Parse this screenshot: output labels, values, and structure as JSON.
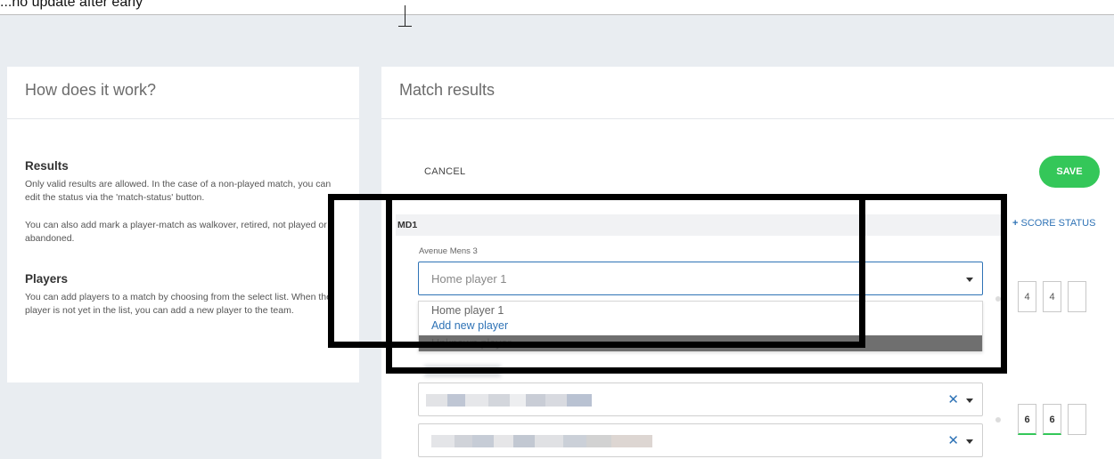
{
  "top": {
    "fragment_text": "...no update after early"
  },
  "left_panel": {
    "title": "How does it work?",
    "sections": [
      {
        "heading": "Results",
        "paragraphs": [
          "Only valid results are allowed. In the case of a non-played match, you can edit the status via the 'match-status' button.",
          "You can also add mark a player-match as walkover, retired, not played or abandoned."
        ]
      },
      {
        "heading": "Players",
        "paragraphs": [
          "You can add players to a match by choosing from the select list. When the player is not yet in the list, you can add a new player to the team."
        ]
      }
    ]
  },
  "right_panel": {
    "title": "Match results",
    "cancel_label": "CANCEL",
    "save_label": "SAVE",
    "match_label": "MD1",
    "score_status_label": "SCORE STATUS",
    "team_name": "Avenue Mens 3",
    "home_select": {
      "placeholder": "Home player 1",
      "options": [
        "Home player 1",
        "Add new player",
        "Unknown player"
      ]
    },
    "scores_row1": [
      "4",
      "4",
      ""
    ],
    "scores_row2": [
      "6",
      "6",
      ""
    ]
  },
  "colors": {
    "accent": "#2f73b6",
    "save": "#34c759",
    "highlight_border": "#000000"
  },
  "icons": [
    "caret-down-icon",
    "plus-icon",
    "clear-x-icon"
  ]
}
